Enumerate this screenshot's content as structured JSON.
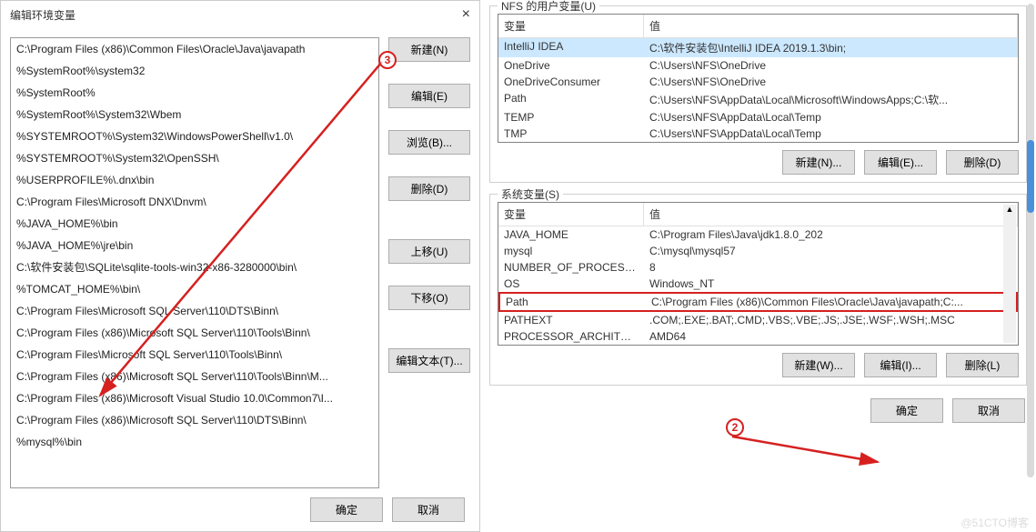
{
  "leftDialog": {
    "title": "编辑环境变量",
    "paths": [
      "C:\\Program Files (x86)\\Common Files\\Oracle\\Java\\javapath",
      "%SystemRoot%\\system32",
      "%SystemRoot%",
      "%SystemRoot%\\System32\\Wbem",
      "%SYSTEMROOT%\\System32\\WindowsPowerShell\\v1.0\\",
      "%SYSTEMROOT%\\System32\\OpenSSH\\",
      "%USERPROFILE%\\.dnx\\bin",
      "C:\\Program Files\\Microsoft DNX\\Dnvm\\",
      "%JAVA_HOME%\\bin",
      "%JAVA_HOME%\\jre\\bin",
      "C:\\软件安装包\\SQLite\\sqlite-tools-win32-x86-3280000\\bin\\",
      "%TOMCAT_HOME%\\bin\\",
      "C:\\Program Files\\Microsoft SQL Server\\110\\DTS\\Binn\\",
      "C:\\Program Files (x86)\\Microsoft SQL Server\\110\\Tools\\Binn\\",
      "C:\\Program Files\\Microsoft SQL Server\\110\\Tools\\Binn\\",
      "C:\\Program Files (x86)\\Microsoft SQL Server\\110\\Tools\\Binn\\M...",
      "C:\\Program Files (x86)\\Microsoft Visual Studio 10.0\\Common7\\I...",
      "C:\\Program Files (x86)\\Microsoft SQL Server\\110\\DTS\\Binn\\",
      "%mysql%\\bin"
    ],
    "buttons": {
      "new": "新建(N)",
      "edit": "编辑(E)",
      "browse": "浏览(B)...",
      "delete": "删除(D)",
      "moveUp": "上移(U)",
      "moveDown": "下移(O)",
      "editText": "编辑文本(T)...",
      "ok": "确定",
      "cancel": "取消"
    }
  },
  "rightPanel": {
    "userVars": {
      "title": "NFS 的用户变量(U)",
      "headerName": "变量",
      "headerValue": "值",
      "rows": [
        {
          "name": "IntelliJ IDEA",
          "value": "C:\\软件安装包\\IntelliJ IDEA 2019.1.3\\bin;"
        },
        {
          "name": "OneDrive",
          "value": "C:\\Users\\NFS\\OneDrive"
        },
        {
          "name": "OneDriveConsumer",
          "value": "C:\\Users\\NFS\\OneDrive"
        },
        {
          "name": "Path",
          "value": "C:\\Users\\NFS\\AppData\\Local\\Microsoft\\WindowsApps;C:\\软..."
        },
        {
          "name": "TEMP",
          "value": "C:\\Users\\NFS\\AppData\\Local\\Temp"
        },
        {
          "name": "TMP",
          "value": "C:\\Users\\NFS\\AppData\\Local\\Temp"
        }
      ],
      "buttons": {
        "new": "新建(N)...",
        "edit": "编辑(E)...",
        "delete": "删除(D)"
      }
    },
    "sysVars": {
      "title": "系统变量(S)",
      "headerName": "变量",
      "headerValue": "值",
      "rows": [
        {
          "name": "JAVA_HOME",
          "value": "C:\\Program Files\\Java\\jdk1.8.0_202"
        },
        {
          "name": "mysql",
          "value": "C:\\mysql\\mysql57"
        },
        {
          "name": "NUMBER_OF_PROCESSORS",
          "value": "8"
        },
        {
          "name": "OS",
          "value": "Windows_NT"
        },
        {
          "name": "Path",
          "value": "C:\\Program Files (x86)\\Common Files\\Oracle\\Java\\javapath;C:..."
        },
        {
          "name": "PATHEXT",
          "value": ".COM;.EXE;.BAT;.CMD;.VBS;.VBE;.JS;.JSE;.WSF;.WSH;.MSC"
        },
        {
          "name": "PROCESSOR_ARCHITECT...",
          "value": "AMD64"
        }
      ],
      "buttons": {
        "new": "新建(W)...",
        "edit": "编辑(I)...",
        "delete": "删除(L)"
      }
    },
    "bottom": {
      "ok": "确定",
      "cancel": "取消"
    }
  },
  "annotations": {
    "num2": "2",
    "num3": "3"
  },
  "watermark": "@51CTO博客"
}
